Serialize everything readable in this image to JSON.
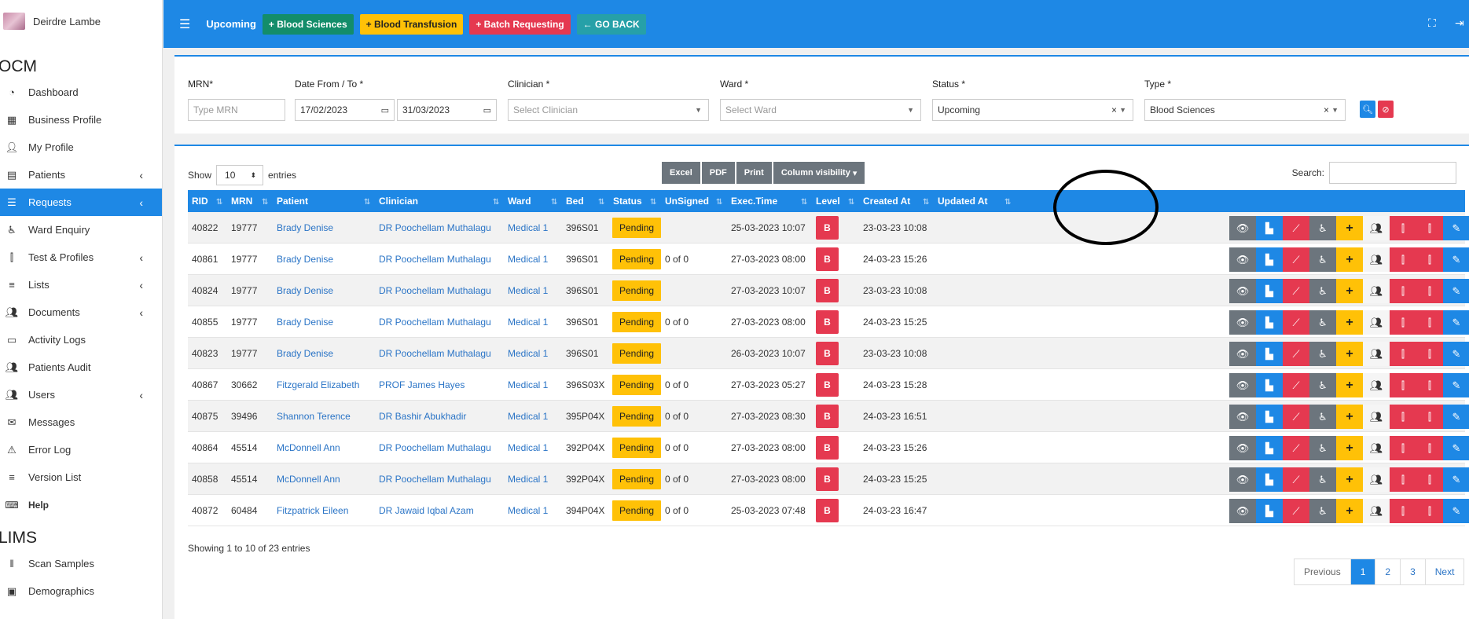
{
  "sidebar": {
    "user_name": "Deirdre Lambe",
    "ocm_title": "OCM",
    "lims_title": "LIMS",
    "ocm_items": [
      {
        "label": "Dashboard",
        "icon": "dashboard-icon"
      },
      {
        "label": "Business Profile",
        "icon": "building-icon"
      },
      {
        "label": "My Profile",
        "icon": "user-icon"
      },
      {
        "label": "Patients",
        "icon": "id-card-icon",
        "chevron": true
      },
      {
        "label": "Requests",
        "icon": "database-icon",
        "chevron": true,
        "active": true
      },
      {
        "label": "Ward Enquiry",
        "icon": "wheelchair-icon"
      },
      {
        "label": "Test & Profiles",
        "icon": "vials-icon",
        "chevron": true
      },
      {
        "label": "Lists",
        "icon": "list-icon",
        "chevron": true
      },
      {
        "label": "Documents",
        "icon": "users-icon",
        "chevron": true
      },
      {
        "label": "Activity Logs",
        "icon": "cash-register-icon"
      },
      {
        "label": "Patients Audit",
        "icon": "users-icon"
      },
      {
        "label": "Users",
        "icon": "users-icon",
        "chevron": true
      },
      {
        "label": "Messages",
        "icon": "envelope-icon"
      },
      {
        "label": "Error Log",
        "icon": "warning-icon"
      },
      {
        "label": "Version List",
        "icon": "list-icon"
      },
      {
        "label": "Help",
        "icon": "keyboard-icon"
      }
    ],
    "lims_items": [
      {
        "label": "Scan Samples",
        "icon": "barcode-icon"
      },
      {
        "label": "Demographics",
        "icon": "user-card-icon"
      }
    ]
  },
  "topbar": {
    "title": "Upcoming",
    "buttons": [
      "Blood Sciences",
      "Blood Transfusion",
      "Batch Requesting",
      "GO BACK"
    ]
  },
  "filters": {
    "mrn_label": "MRN*",
    "mrn_placeholder": "Type MRN",
    "date_label": "Date From / To *",
    "date_from": "17/02/2023",
    "date_to": "31/03/2023",
    "clinician_label": "Clinician *",
    "clinician_placeholder": "Select Clinician",
    "ward_label": "Ward *",
    "ward_placeholder": "Select Ward",
    "status_label": "Status *",
    "status_value": "Upcoming",
    "type_label": "Type *",
    "type_value": "Blood Sciences"
  },
  "table_controls": {
    "show_label": "Show",
    "entries_label": "entries",
    "page_length": "10",
    "export_buttons": [
      "Excel",
      "PDF",
      "Print",
      "Column visibility"
    ],
    "search_label": "Search:"
  },
  "table": {
    "columns": [
      "RID",
      "MRN",
      "Patient",
      "Clinician",
      "Ward",
      "Bed",
      "Status",
      "UnSigned",
      "Exec.Time",
      "Level",
      "Created At",
      "Updated At"
    ],
    "rows": [
      {
        "rid": "40822",
        "mrn": "19777",
        "patient": "Brady Denise",
        "clinician": "DR Poochellam Muthalagu",
        "ward": "Medical 1",
        "bed": "396S01",
        "status": "Pending",
        "unsigned": "",
        "exec": "25-03-2023 10:07",
        "level": "B",
        "created": "23-03-23 10:08",
        "updated": ""
      },
      {
        "rid": "40861",
        "mrn": "19777",
        "patient": "Brady Denise",
        "clinician": "DR Poochellam Muthalagu",
        "ward": "Medical 1",
        "bed": "396S01",
        "status": "Pending",
        "unsigned": "0 of 0",
        "exec": "27-03-2023 08:00",
        "level": "B",
        "created": "24-03-23 15:26",
        "updated": ""
      },
      {
        "rid": "40824",
        "mrn": "19777",
        "patient": "Brady Denise",
        "clinician": "DR Poochellam Muthalagu",
        "ward": "Medical 1",
        "bed": "396S01",
        "status": "Pending",
        "unsigned": "",
        "exec": "27-03-2023 10:07",
        "level": "B",
        "created": "23-03-23 10:08",
        "updated": ""
      },
      {
        "rid": "40855",
        "mrn": "19777",
        "patient": "Brady Denise",
        "clinician": "DR Poochellam Muthalagu",
        "ward": "Medical 1",
        "bed": "396S01",
        "status": "Pending",
        "unsigned": "0 of 0",
        "exec": "27-03-2023 08:00",
        "level": "B",
        "created": "24-03-23 15:25",
        "updated": ""
      },
      {
        "rid": "40823",
        "mrn": "19777",
        "patient": "Brady Denise",
        "clinician": "DR Poochellam Muthalagu",
        "ward": "Medical 1",
        "bed": "396S01",
        "status": "Pending",
        "unsigned": "",
        "exec": "26-03-2023 10:07",
        "level": "B",
        "created": "23-03-23 10:08",
        "updated": ""
      },
      {
        "rid": "40867",
        "mrn": "30662",
        "patient": "Fitzgerald Elizabeth",
        "clinician": "PROF James Hayes",
        "ward": "Medical 1",
        "bed": "396S03X",
        "status": "Pending",
        "unsigned": "0 of 0",
        "exec": "27-03-2023 05:27",
        "level": "B",
        "created": "24-03-23 15:28",
        "updated": ""
      },
      {
        "rid": "40875",
        "mrn": "39496",
        "patient": "Shannon Terence",
        "clinician": "DR Bashir Abukhadir",
        "ward": "Medical 1",
        "bed": "395P04X",
        "status": "Pending",
        "unsigned": "0 of 0",
        "exec": "27-03-2023 08:30",
        "level": "B",
        "created": "24-03-23 16:51",
        "updated": ""
      },
      {
        "rid": "40864",
        "mrn": "45514",
        "patient": "McDonnell Ann",
        "clinician": "DR Poochellam Muthalagu",
        "ward": "Medical 1",
        "bed": "392P04X",
        "status": "Pending",
        "unsigned": "0 of 0",
        "exec": "27-03-2023 08:00",
        "level": "B",
        "created": "24-03-23 15:26",
        "updated": ""
      },
      {
        "rid": "40858",
        "mrn": "45514",
        "patient": "McDonnell Ann",
        "clinician": "DR Poochellam Muthalagu",
        "ward": "Medical 1",
        "bed": "392P04X",
        "status": "Pending",
        "unsigned": "0 of 0",
        "exec": "27-03-2023 08:00",
        "level": "B",
        "created": "24-03-23 15:25",
        "updated": ""
      },
      {
        "rid": "40872",
        "mrn": "60484",
        "patient": "Fitzpatrick Eileen",
        "clinician": "DR Jawaid Iqbal Azam",
        "ward": "Medical 1",
        "bed": "394P04X",
        "status": "Pending",
        "unsigned": "0 of 0",
        "exec": "25-03-2023 07:48",
        "level": "B",
        "created": "24-03-23 16:47",
        "updated": ""
      }
    ],
    "info": "Showing 1 to 10 of 23 entries"
  },
  "pagination": {
    "prev": "Previous",
    "pages": [
      "1",
      "2",
      "3"
    ],
    "next": "Next",
    "current": "1"
  },
  "colors": {
    "primary": "#1e88e5",
    "pending": "#ffc107",
    "danger": "#e53950",
    "success": "#138d6a"
  }
}
